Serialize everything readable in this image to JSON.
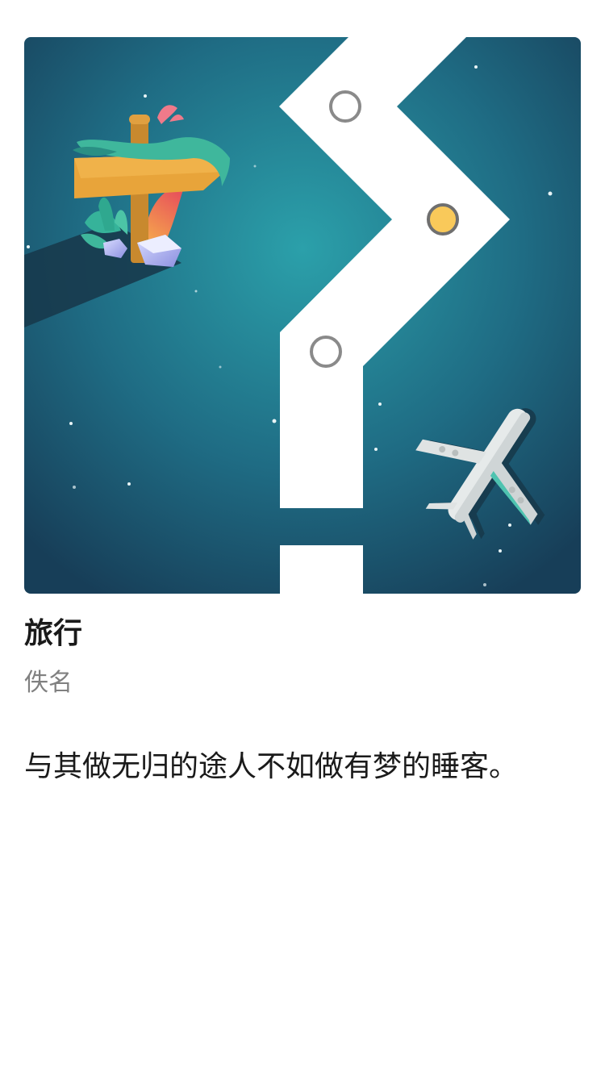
{
  "illustration": {
    "description_icon": "travel-illustration",
    "colors": {
      "background_center": "#2a9fa8",
      "background_edge": "#1a4660",
      "path": "#ffffff",
      "active_node": "#f9c95a",
      "node_stroke": "#8a8a8a"
    }
  },
  "poem": {
    "title": "旅行",
    "author": "佚名",
    "quote": "与其做无归的途人不如做有梦的睡客。"
  }
}
